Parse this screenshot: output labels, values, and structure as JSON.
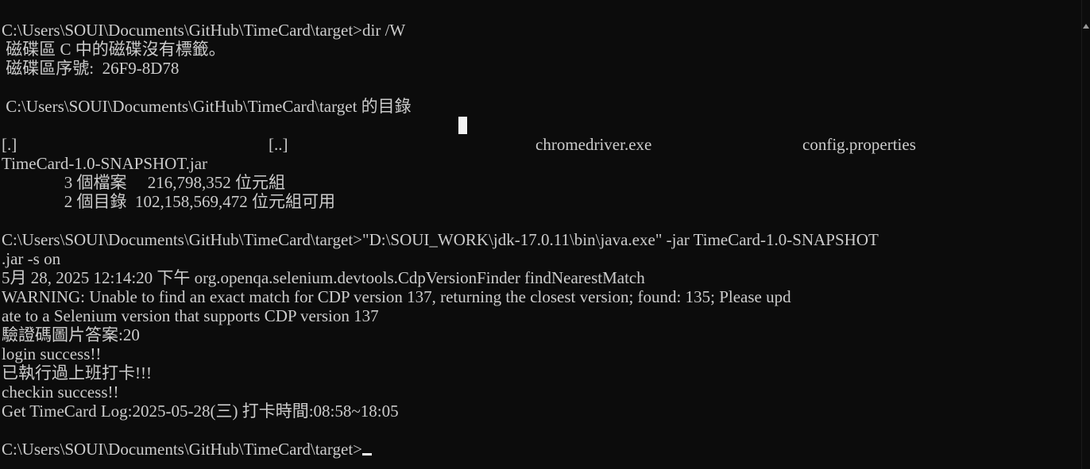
{
  "colors": {
    "background": "#0c0c0c",
    "text": "#cccccc",
    "cursor": "#f2f2f2"
  },
  "console": {
    "line_01": "C:\\Users\\SOUI\\Documents\\GitHub\\TimeCard\\target>dir /W",
    "line_02": " 磁碟區 C 中的磁碟沒有標籤。",
    "line_03": " 磁碟區序號:  26F9-8D78",
    "line_04": "",
    "line_05": " C:\\Users\\SOUI\\Documents\\GitHub\\TimeCard\\target 的目錄",
    "line_06": "",
    "dir_listing": [
      "[.]",
      "[..]",
      "chromedriver.exe",
      "config.properties"
    ],
    "line_08": "TimeCard-1.0-SNAPSHOT.jar",
    "line_09": "               3 個檔案     216,798,352 位元組",
    "line_10": "               2 個目錄  102,158,569,472 位元組可用",
    "line_11": "",
    "line_12": "C:\\Users\\SOUI\\Documents\\GitHub\\TimeCard\\target>\"D:\\SOUI_WORK\\jdk-17.0.11\\bin\\java.exe\" -jar TimeCard-1.0-SNAPSHOT",
    "line_13": ".jar -s on",
    "line_14": "5月 28, 2025 12:14:20 下午 org.openqa.selenium.devtools.CdpVersionFinder findNearestMatch",
    "line_15": "WARNING: Unable to find an exact match for CDP version 137, returning the closest version; found: 135; Please upd",
    "line_16": "ate to a Selenium version that supports CDP version 137",
    "line_17": "驗證碼圖片答案:20",
    "line_18": "login success!!",
    "line_19": "已執行過上班打卡!!!",
    "line_20": "checkin success!!",
    "line_21": "Get TimeCard Log:2025-05-28(三) 打卡時間:08:58~18:05",
    "line_22": "",
    "prompt": "C:\\Users\\SOUI\\Documents\\GitHub\\TimeCard\\target>"
  }
}
